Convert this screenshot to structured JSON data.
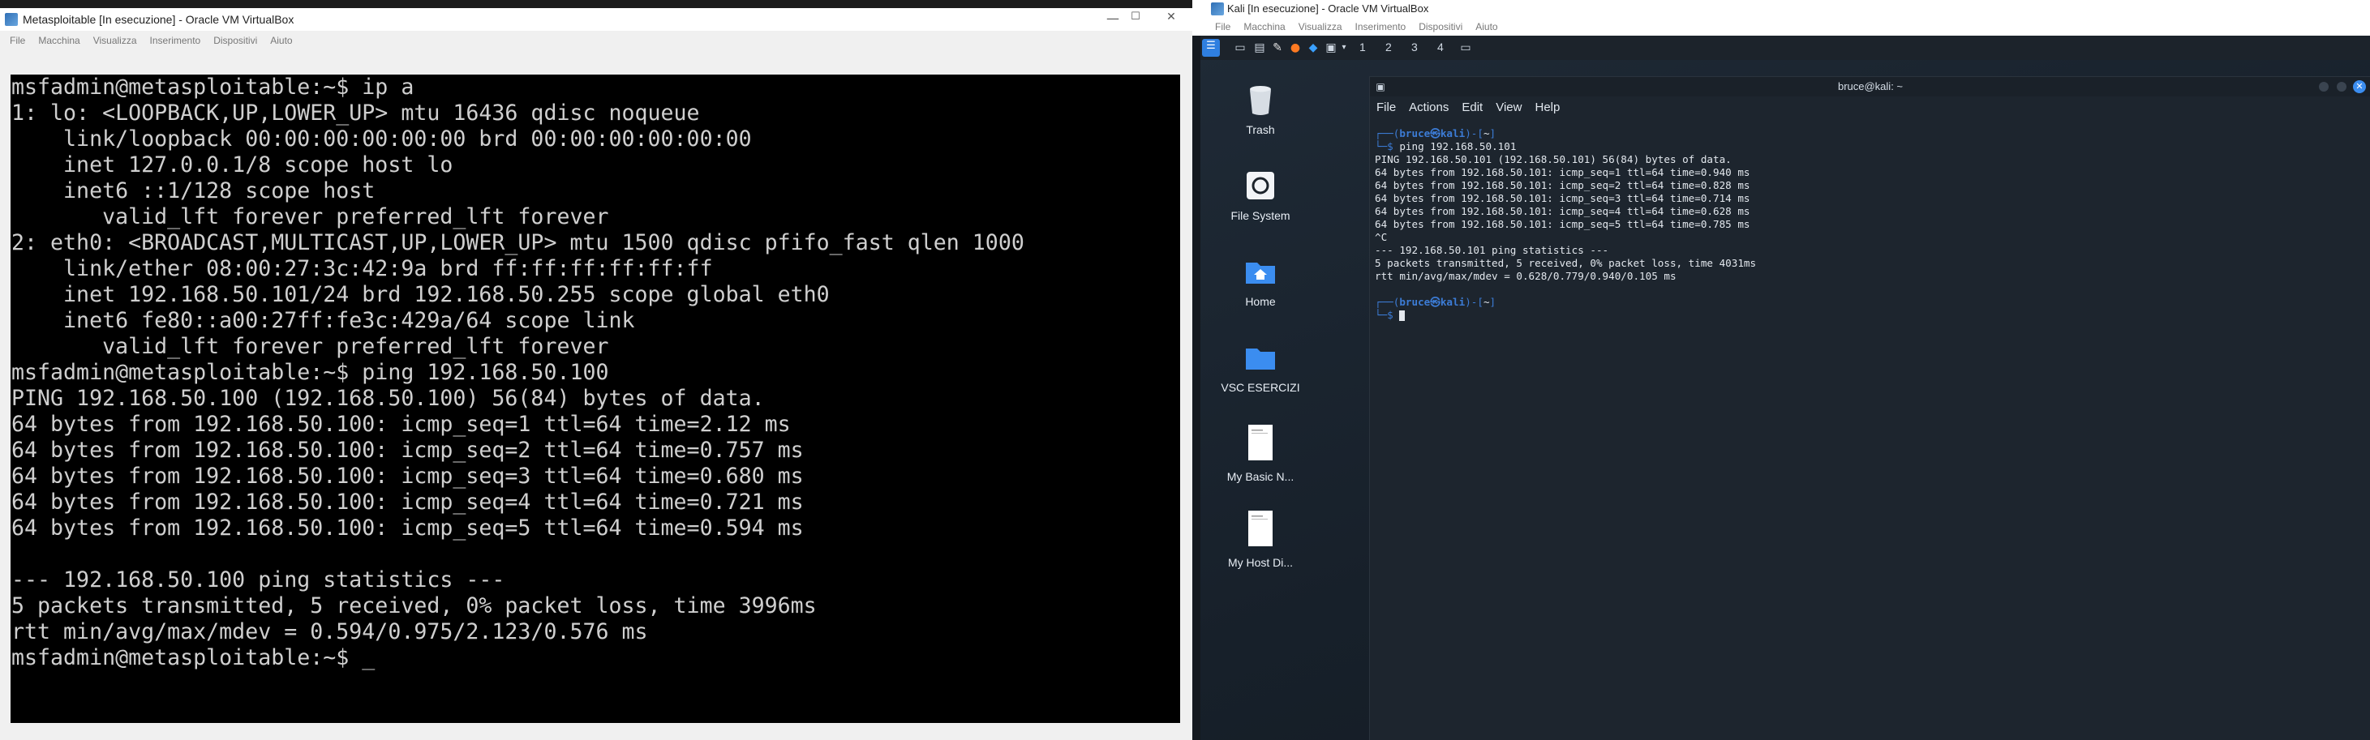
{
  "left_window": {
    "title": "Metasploitable [In esecuzione] - Oracle VM VirtualBox",
    "controls": {
      "minimize": "—",
      "maximize": "☐",
      "close": "✕"
    },
    "menu": [
      "File",
      "Macchina",
      "Visualizza",
      "Inserimento",
      "Dispositivi",
      "Aiuto"
    ],
    "console_lines": [
      "msfadmin@metasploitable:~$ ip a",
      "1: lo: <LOOPBACK,UP,LOWER_UP> mtu 16436 qdisc noqueue",
      "    link/loopback 00:00:00:00:00:00 brd 00:00:00:00:00:00",
      "    inet 127.0.0.1/8 scope host lo",
      "    inet6 ::1/128 scope host",
      "       valid_lft forever preferred_lft forever",
      "2: eth0: <BROADCAST,MULTICAST,UP,LOWER_UP> mtu 1500 qdisc pfifo_fast qlen 1000",
      "    link/ether 08:00:27:3c:42:9a brd ff:ff:ff:ff:ff:ff",
      "    inet 192.168.50.101/24 brd 192.168.50.255 scope global eth0",
      "    inet6 fe80::a00:27ff:fe3c:429a/64 scope link",
      "       valid_lft forever preferred_lft forever",
      "msfadmin@metasploitable:~$ ping 192.168.50.100",
      "PING 192.168.50.100 (192.168.50.100) 56(84) bytes of data.",
      "64 bytes from 192.168.50.100: icmp_seq=1 ttl=64 time=2.12 ms",
      "64 bytes from 192.168.50.100: icmp_seq=2 ttl=64 time=0.757 ms",
      "64 bytes from 192.168.50.100: icmp_seq=3 ttl=64 time=0.680 ms",
      "64 bytes from 192.168.50.100: icmp_seq=4 ttl=64 time=0.721 ms",
      "64 bytes from 192.168.50.100: icmp_seq=5 ttl=64 time=0.594 ms",
      "",
      "--- 192.168.50.100 ping statistics ---",
      "5 packets transmitted, 5 received, 0% packet loss, time 3996ms",
      "rtt min/avg/max/mdev = 0.594/0.975/2.123/0.576 ms",
      "msfadmin@metasploitable:~$ _"
    ]
  },
  "right_window": {
    "title": "Kali [In esecuzione] - Oracle VM VirtualBox",
    "menu": [
      "File",
      "Macchina",
      "Visualizza",
      "Inserimento",
      "Dispositivi",
      "Aiuto"
    ],
    "panel": {
      "workspaces": [
        "1",
        "2",
        "3",
        "4"
      ],
      "icons": [
        "kali-menu-icon",
        "desktop-icon",
        "files-icon",
        "text-editor-icon",
        "firefox-icon",
        "vscode-icon",
        "terminal-icon",
        "dropdown-icon",
        "window-icon"
      ]
    },
    "desktop_items": [
      "Trash",
      "File System",
      "Home",
      "VSC ESERCIZI",
      "My Basic N...",
      "My Host Di..."
    ],
    "terminal": {
      "title": "bruce@kali: ~",
      "menu": [
        "File",
        "Actions",
        "Edit",
        "View",
        "Help"
      ],
      "prompt_user": "bruce㉿kali",
      "prompt_dir": "~",
      "command": "ping 192.168.50.101",
      "output": [
        "PING 192.168.50.101 (192.168.50.101) 56(84) bytes of data.",
        "64 bytes from 192.168.50.101: icmp_seq=1 ttl=64 time=0.940 ms",
        "64 bytes from 192.168.50.101: icmp_seq=2 ttl=64 time=0.828 ms",
        "64 bytes from 192.168.50.101: icmp_seq=3 ttl=64 time=0.714 ms",
        "64 bytes from 192.168.50.101: icmp_seq=4 ttl=64 time=0.628 ms",
        "64 bytes from 192.168.50.101: icmp_seq=5 ttl=64 time=0.785 ms",
        "^C",
        "--- 192.168.50.101 ping statistics ---",
        "5 packets transmitted, 5 received, 0% packet loss, time 4031ms",
        "rtt min/avg/max/mdev = 0.628/0.779/0.940/0.105 ms"
      ]
    }
  }
}
